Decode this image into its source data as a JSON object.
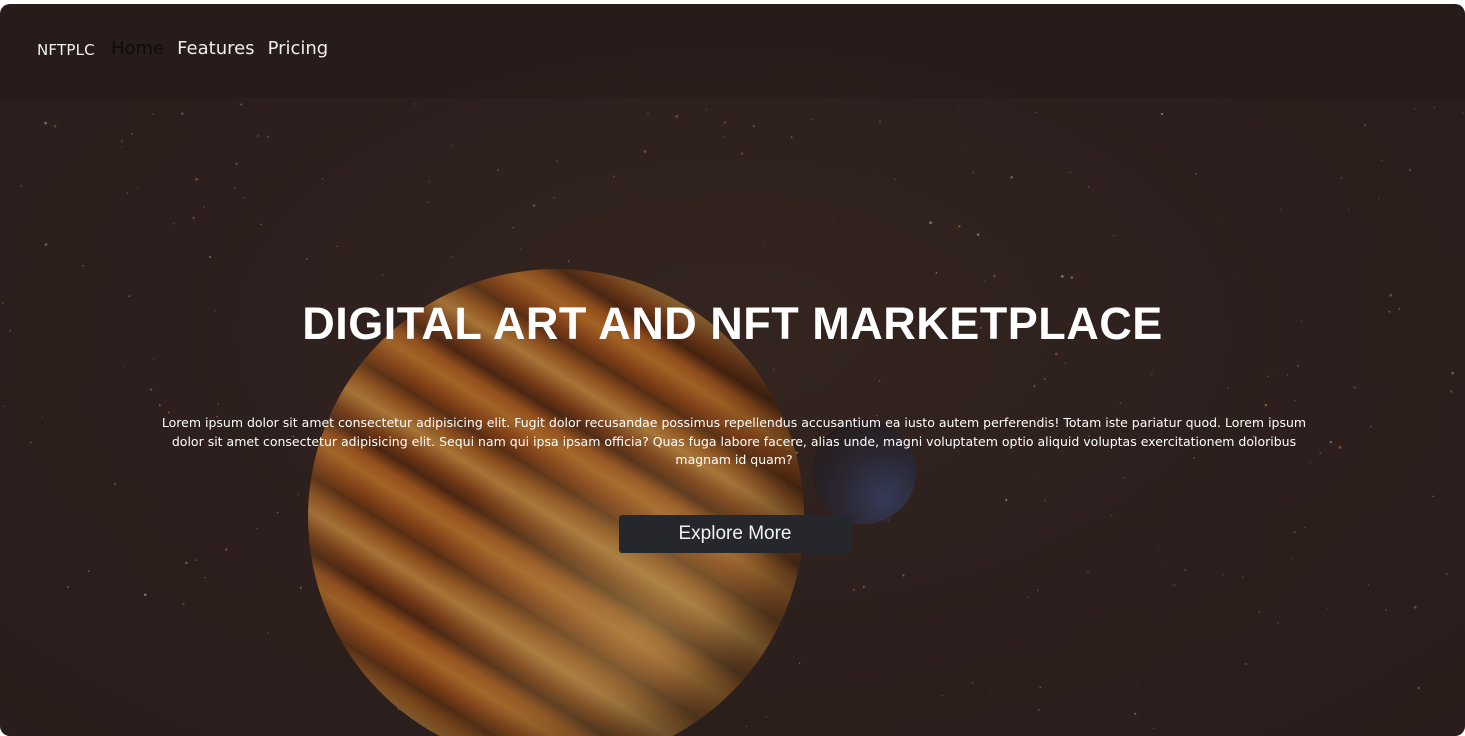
{
  "navbar": {
    "brand": "NFTPLC",
    "links": [
      {
        "label": "Home",
        "active": true
      },
      {
        "label": "Features",
        "active": false
      },
      {
        "label": "Pricing",
        "active": false
      }
    ]
  },
  "hero": {
    "title": "DIGITAL ART AND NFT MARKETPLACE",
    "description": "Lorem ipsum dolor sit amet consectetur adipisicing elit. Fugit dolor recusandae possimus repellendus accusantium ea iusto autem perferendis! Totam iste pariatur quod. Lorem ipsum dolor sit amet consectetur adipisicing elit. Sequi nam qui ipsa ipsam officia? Quas fuga labore facere, alias unde, magni voluptatem optio aliquid voluptas exercitationem doloribus magnam id quam?",
    "cta_label": "Explore More"
  },
  "colors": {
    "background": "#2e211f",
    "button": "#25272c",
    "planet": "#c9681e"
  }
}
